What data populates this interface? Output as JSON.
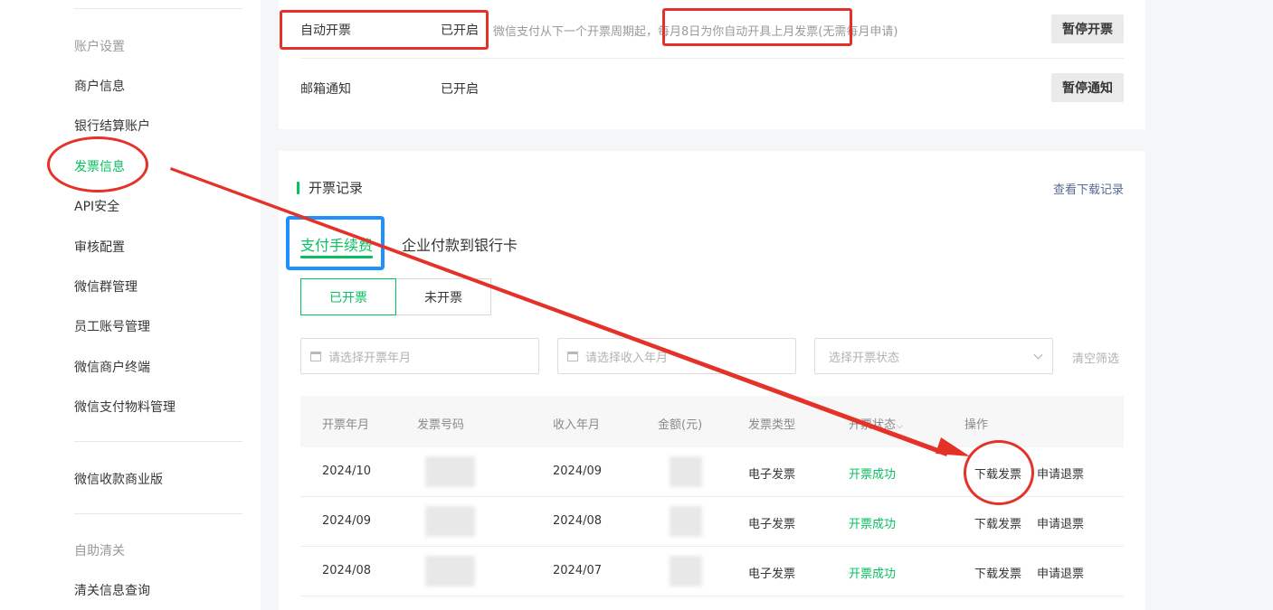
{
  "sidebar": {
    "group_account": "账户设置",
    "items": [
      {
        "label": "商户信息"
      },
      {
        "label": "银行结算账户"
      },
      {
        "label": "发票信息"
      },
      {
        "label": "API安全"
      },
      {
        "label": "审核配置"
      },
      {
        "label": "微信群管理"
      },
      {
        "label": "员工账号管理"
      },
      {
        "label": "微信商户终端"
      },
      {
        "label": "微信支付物料管理"
      }
    ],
    "item_business": "微信收款商业版",
    "group_self": "自助清关",
    "item_customs": "清关信息查询"
  },
  "settings": {
    "auto_invoice": {
      "label": "自动开票",
      "status": "已开启",
      "desc_prefix": "微信支付从下一个开票周期起，",
      "desc_highlight": "每月8日为你自动开具上月发票",
      "desc_suffix": "(无需每月申请)",
      "button": "暂停开票"
    },
    "email_notify": {
      "label": "邮箱通知",
      "status": "已开启",
      "button": "暂停通知"
    }
  },
  "records": {
    "title": "开票记录",
    "view_downloads": "查看下载记录",
    "tabs": [
      "支付手续费",
      "企业付款到银行卡"
    ],
    "segments": [
      "已开票",
      "未开票"
    ],
    "filters": {
      "invoice_month_placeholder": "请选择开票年月",
      "income_month_placeholder": "请选择收入年月",
      "status_placeholder": "选择开票状态",
      "clear": "清空筛选"
    },
    "columns": [
      "开票年月",
      "发票号码",
      "收入年月",
      "金额(元)",
      "发票类型",
      "开票状态",
      "操作"
    ],
    "rows": [
      {
        "invoice_month": "2024/10",
        "income_month": "2024/09",
        "type": "电子发票",
        "status": "开票成功",
        "action_download": "下载发票",
        "action_refund": "申请退票"
      },
      {
        "invoice_month": "2024/09",
        "income_month": "2024/08",
        "type": "电子发票",
        "status": "开票成功",
        "action_download": "下载发票",
        "action_refund": "申请退票"
      },
      {
        "invoice_month": "2024/08",
        "income_month": "2024/07",
        "type": "电子发票",
        "status": "开票成功",
        "action_download": "下载发票",
        "action_refund": "申请退票"
      }
    ]
  },
  "colors": {
    "accent": "#07c160",
    "link": "#576b95",
    "annotation_red": "#e53228",
    "annotation_blue": "#1e90ff"
  }
}
